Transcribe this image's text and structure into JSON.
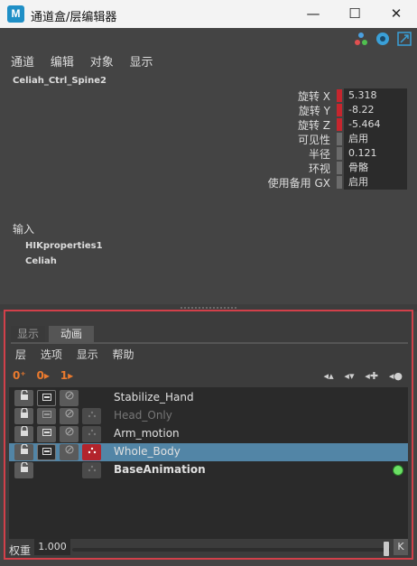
{
  "window": {
    "title": "通道盒/层编辑器",
    "app_icon_label": "M",
    "min_glyph": "—",
    "max_glyph": "☐",
    "close_glyph": "✕"
  },
  "channel_box": {
    "menu": [
      "通道",
      "编辑",
      "对象",
      "显示"
    ],
    "object_name": "Celiah_Ctrl_Spine2",
    "attributes": [
      {
        "label": "旋转 X",
        "value": "5.318",
        "keyed": true
      },
      {
        "label": "旋转 Y",
        "value": "-8.22",
        "keyed": true
      },
      {
        "label": "旋转 Z",
        "value": "-5.464",
        "keyed": true
      },
      {
        "label": "可见性",
        "value": "启用",
        "keyed": false
      },
      {
        "label": "半径",
        "value": "0.121",
        "keyed": false
      },
      {
        "label": "环视",
        "value": "骨骼",
        "keyed": false
      },
      {
        "label": "使用备用 GX",
        "value": "启用",
        "keyed": false
      }
    ],
    "inputs_title": "输入",
    "inputs": [
      "HIKproperties1",
      "Celiah"
    ]
  },
  "layer_editor": {
    "tabs": [
      "显示",
      "动画"
    ],
    "active_tab": "动画",
    "menu": [
      "层",
      "选项",
      "显示",
      "帮助"
    ],
    "left_tools": [
      "0⁺",
      "0▸",
      "1▸"
    ],
    "right_tools": [
      "◂▴",
      "◂▾",
      "◂✚",
      "◂●"
    ],
    "layers": [
      {
        "name": "Stabilize_Hand",
        "selected": false,
        "muted": false,
        "bold": false
      },
      {
        "name": "Head_Only",
        "selected": false,
        "muted": true,
        "bold": false
      },
      {
        "name": "Arm_motion",
        "selected": false,
        "muted": false,
        "bold": false
      },
      {
        "name": "Whole_Body",
        "selected": true,
        "muted": false,
        "bold": false
      },
      {
        "name": "BaseAnimation",
        "selected": false,
        "muted": false,
        "bold": true
      }
    ],
    "weight_label": "权重",
    "weight_value": "1.000",
    "weight_fraction": 1.0,
    "key_label": "K"
  },
  "colors": {
    "accent_red": "#c6262e",
    "selection_blue": "#5285a6",
    "highlight_border": "#d2404a",
    "active_green": "#6be064"
  }
}
